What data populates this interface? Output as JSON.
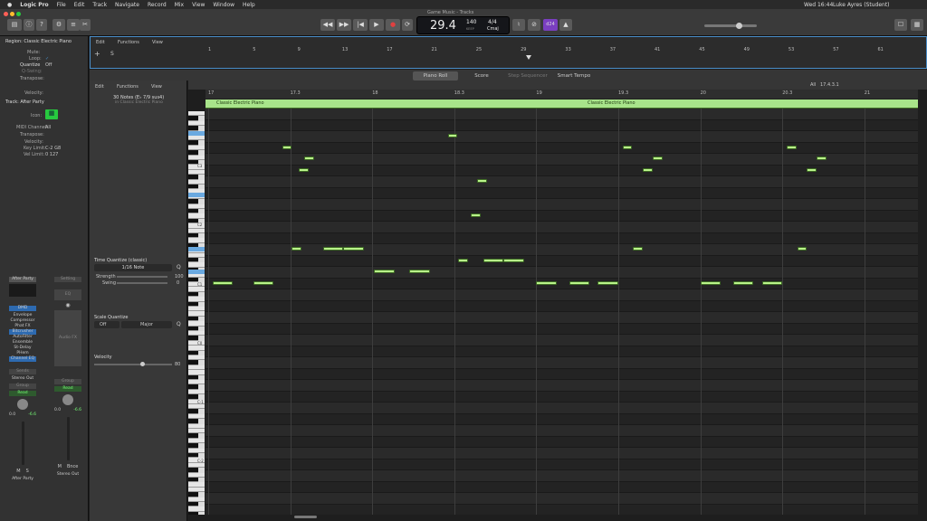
{
  "menubar": {
    "app": "Logic Pro",
    "items": [
      "File",
      "Edit",
      "Track",
      "Navigate",
      "Record",
      "Mix",
      "View",
      "Window",
      "Help"
    ],
    "right": {
      "datetime": "Wed 16:44",
      "user": "Luke Ayres (Student)"
    }
  },
  "window": {
    "title": "Game Music - Tracks"
  },
  "transport": {
    "position": "29.4",
    "tempo": "140",
    "tempo_label": "KEEP",
    "sig": "4/4",
    "key": "Cmaj",
    "counter": "d24"
  },
  "left": {
    "region_header": "Region: Classic Electric Piano",
    "mute": "Mute:",
    "loop": "Loop:",
    "quantize": "Quantize",
    "quantize_val": "Off",
    "qswing": "Q-Swing:",
    "transpose": "Transpose:",
    "velocity": "Velocity:",
    "track_header": "Track: After Party",
    "icon": "Icon:",
    "midi_channel": "MIDI Channel:",
    "midi_channel_val": "All",
    "track_transpose": "Transpose:",
    "track_velocity": "Velocity:",
    "key_limit": "Key Limit:",
    "key_limit_val": "C-2  G8",
    "vel_limit": "Vel Limit:",
    "vel_limit_val": "0  127",
    "strip1": {
      "name": "After Party",
      "plugins": [
        "DMD",
        "Envelope",
        "Compressor",
        "Phat FX",
        "Bitcrusher",
        "AutoFilter",
        "Ensemble",
        "St-Delay",
        "PHem",
        "Channel EQ"
      ],
      "send": "Sends",
      "out": "Stereo Out",
      "group": "Group",
      "read": "Read",
      "vol": "0.0",
      "pan": "-6.6",
      "m": "M",
      "s": "S",
      "bottom": "After Party"
    },
    "strip2": {
      "name": "Setting",
      "eq": "EQ",
      "fx": "Audio FX",
      "group": "Group",
      "read": "Read",
      "vol": "0.0",
      "pan": "-6.6",
      "m": "M",
      "bnce": "Bnce",
      "bottom": "Stereo Out"
    }
  },
  "tracks": {
    "menu": [
      "Edit",
      "Functions",
      "View"
    ],
    "ruler": [
      "1",
      "5",
      "9",
      "13",
      "17",
      "21",
      "25",
      "29",
      "33",
      "37",
      "41",
      "45",
      "49",
      "53",
      "57",
      "61"
    ]
  },
  "tabs": [
    "Piano Roll",
    "Score",
    "Step Sequencer",
    "Smart Tempo"
  ],
  "pianoroll": {
    "menu": [
      "Edit",
      "Functions",
      "View"
    ],
    "info": "30 Notes (E♭ 7/9 sus4)",
    "info_sub": "in Classic Electric Piano",
    "ruler": [
      "17",
      "17.3",
      "18",
      "18.3",
      "19",
      "19.3",
      "20",
      "20.3",
      "21"
    ],
    "region_name": "Classic Electric Piano",
    "region_name2": "Classic Electric Piano",
    "position": "17.4.3.1",
    "all": "All",
    "octaves": [
      "C3",
      "C2",
      "C1",
      "C0",
      "C-1",
      "C-2"
    ],
    "time_quantize": "Time Quantize (classic)",
    "tq_val": "1/16 Note",
    "strength": "Strength",
    "strength_val": "100",
    "swing": "Swing",
    "swing_val": "0",
    "scale_quantize": "Scale Quantize",
    "sq_off": "Off",
    "sq_scale": "Major",
    "velocity_label": "Velocity",
    "velocity_val": "80"
  },
  "notes": [
    {
      "beat": 0.05,
      "row": 15,
      "len": 0.25
    },
    {
      "beat": 0.55,
      "row": 15,
      "len": 0.25
    },
    {
      "beat": 0.9,
      "row": 3,
      "len": 0.12
    },
    {
      "beat": 1.02,
      "row": 12,
      "len": 0.12
    },
    {
      "beat": 1.17,
      "row": 4,
      "len": 0.12
    },
    {
      "beat": 1.1,
      "row": 5,
      "len": 0.12
    },
    {
      "beat": 1.4,
      "row": 12,
      "len": 0.25
    },
    {
      "beat": 1.65,
      "row": 12,
      "len": 0.25
    },
    {
      "beat": 2.02,
      "row": 14,
      "len": 0.25
    },
    {
      "beat": 2.45,
      "row": 14,
      "len": 0.25
    },
    {
      "beat": 2.92,
      "row": 2,
      "len": 0.12
    },
    {
      "beat": 3.05,
      "row": 13,
      "len": 0.12
    },
    {
      "beat": 3.2,
      "row": 9,
      "len": 0.12
    },
    {
      "beat": 3.28,
      "row": 6,
      "len": 0.12
    },
    {
      "beat": 3.35,
      "row": 13,
      "len": 0.25
    },
    {
      "beat": 3.6,
      "row": 13,
      "len": 0.25
    },
    {
      "beat": 4.0,
      "row": 15,
      "len": 0.25
    },
    {
      "beat": 4.4,
      "row": 15,
      "len": 0.25
    },
    {
      "beat": 4.75,
      "row": 15,
      "len": 0.25
    },
    {
      "beat": 5.05,
      "row": 3,
      "len": 0.12
    },
    {
      "beat": 5.18,
      "row": 12,
      "len": 0.12
    },
    {
      "beat": 5.3,
      "row": 5,
      "len": 0.12
    },
    {
      "beat": 5.42,
      "row": 4,
      "len": 0.12
    },
    {
      "beat": 6.0,
      "row": 15,
      "len": 0.25
    },
    {
      "beat": 6.4,
      "row": 15,
      "len": 0.25
    },
    {
      "beat": 6.75,
      "row": 15,
      "len": 0.25
    },
    {
      "beat": 7.05,
      "row": 3,
      "len": 0.12
    },
    {
      "beat": 7.18,
      "row": 12,
      "len": 0.12
    },
    {
      "beat": 7.3,
      "row": 5,
      "len": 0.12
    },
    {
      "beat": 7.42,
      "row": 4,
      "len": 0.12
    }
  ],
  "colors": {
    "note": "#b9f48a",
    "region": "#a8e48a",
    "accent": "#4a8ec9",
    "record": "#e04040"
  }
}
